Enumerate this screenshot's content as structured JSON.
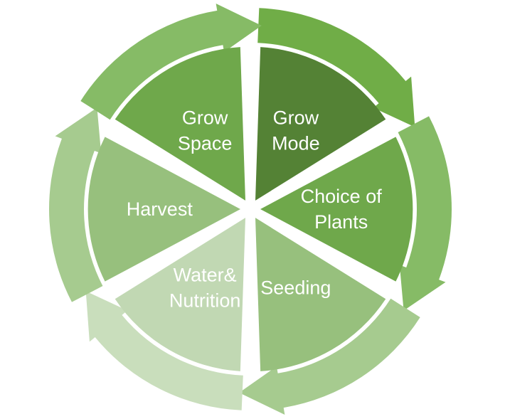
{
  "diagram": {
    "type": "cycle",
    "direction": "clockwise",
    "segments": [
      {
        "id": "grow-mode",
        "lines": [
          "Grow",
          "Mode"
        ],
        "color": "#548235",
        "arrow_color": "#70AD47"
      },
      {
        "id": "choice-of-plants",
        "lines": [
          "Choice of",
          "Plants"
        ],
        "color": "#6FA84B",
        "arrow_color": "#86BB66"
      },
      {
        "id": "seeding",
        "lines": [
          "Seeding"
        ],
        "color": "#97C07D",
        "arrow_color": "#A6CB8F"
      },
      {
        "id": "water-nutrition",
        "lines": [
          "Water&",
          "Nutrition"
        ],
        "color": "#C1D8B3",
        "arrow_color": "#C9DEBC"
      },
      {
        "id": "harvest",
        "lines": [
          "Harvest"
        ],
        "color": "#97C07D",
        "arrow_color": "#A6CB8F"
      },
      {
        "id": "grow-space",
        "lines": [
          "Grow",
          "Space"
        ],
        "color": "#6FA84B",
        "arrow_color": "#86BB66"
      }
    ]
  }
}
